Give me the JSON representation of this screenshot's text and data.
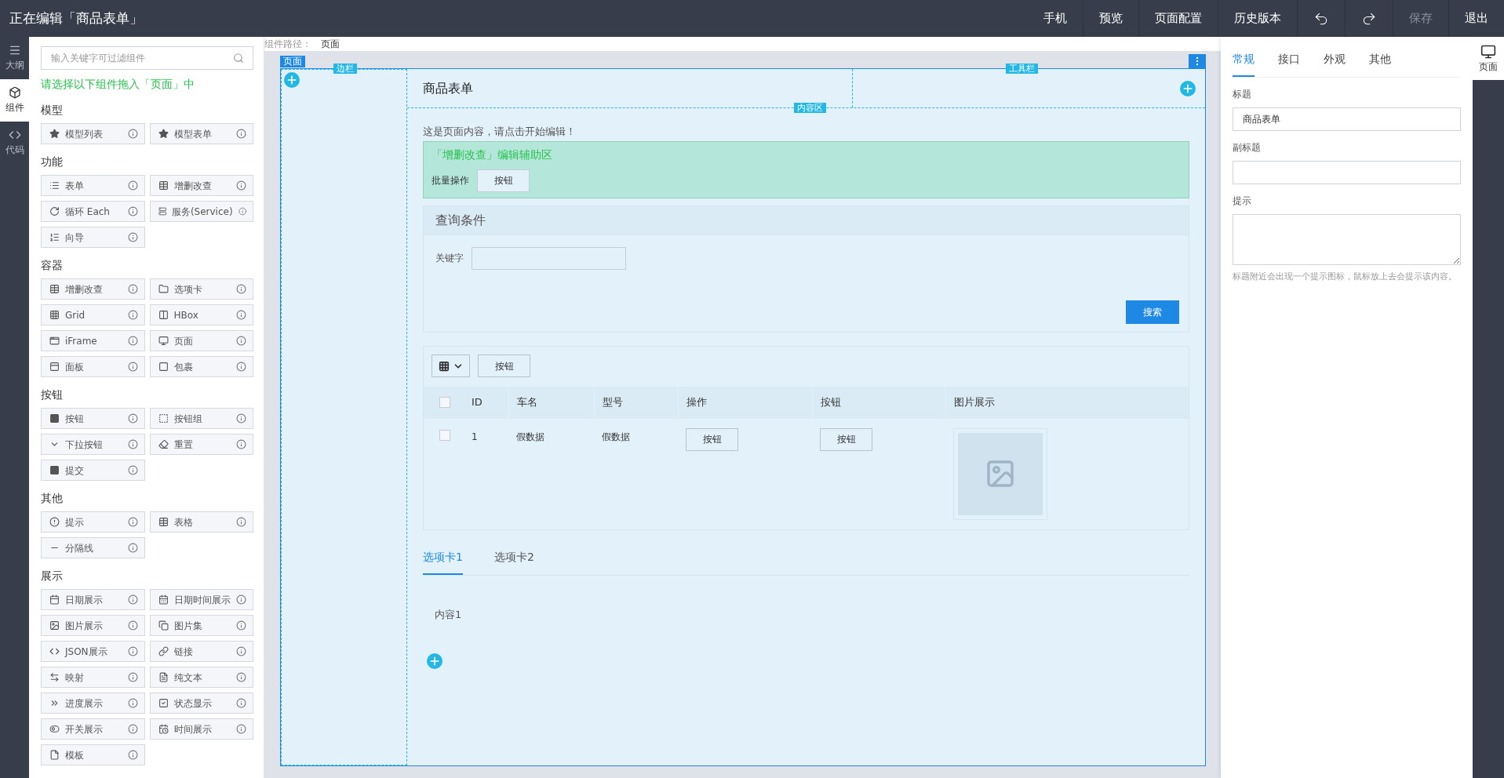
{
  "topbar": {
    "title": "正在编辑「商品表单」",
    "actions": [
      {
        "kind": "text",
        "label": "手机",
        "disabled": false
      },
      {
        "kind": "text",
        "label": "预览",
        "disabled": false
      },
      {
        "kind": "text",
        "label": "页面配置",
        "disabled": false
      },
      {
        "kind": "text",
        "label": "历史版本",
        "disabled": false
      },
      {
        "kind": "undo",
        "disabled": false
      },
      {
        "kind": "redo",
        "disabled": false
      },
      {
        "kind": "text",
        "label": "保存",
        "disabled": true
      },
      {
        "kind": "text",
        "label": "退出",
        "disabled": false
      }
    ]
  },
  "rail": [
    {
      "label": "大纲",
      "selected": false
    },
    {
      "label": "组件",
      "selected": true
    },
    {
      "label": "代码",
      "selected": false
    }
  ],
  "components_panel": {
    "search": {
      "placeholder": "输入关键字可过滤组件"
    },
    "hint": "请选择以下组件拖入「页面」中",
    "groups": [
      {
        "title": "模型",
        "items": [
          "模型列表",
          "模型表单"
        ]
      },
      {
        "title": "功能",
        "items": [
          "表单",
          "增删改查",
          "循环 Each",
          "服务(Service)",
          "向导"
        ]
      },
      {
        "title": "容器",
        "items": [
          "增删改查",
          "选项卡",
          "Grid",
          "HBox",
          "iFrame",
          "页面",
          "面板",
          "包裹"
        ]
      },
      {
        "title": "按钮",
        "items": [
          "按钮",
          "按钮组",
          "下拉按钮",
          "重置",
          "提交"
        ]
      },
      {
        "title": "其他",
        "items": [
          "提示",
          "表格",
          "分隔线"
        ]
      },
      {
        "title": "展示",
        "items": [
          "日期展示",
          "日期时间展示",
          "图片展示",
          "图片集",
          "JSON展示",
          "链接",
          "映射",
          "纯文本",
          "进度展示",
          "状态显示",
          "开关展示",
          "时间展示",
          "模板"
        ]
      }
    ]
  },
  "path": {
    "label": "组件路径：",
    "value": "页面"
  },
  "canvas": {
    "page_tag": "页面",
    "sidebar_tag": "边栏",
    "toolbar_tag": "工具栏",
    "content_tag": "内容区",
    "header_title": "商品表单",
    "intro": "这是页面内容，请点击开始编辑！",
    "crud_helper": {
      "title": "「增删改查」编辑辅助区",
      "batch_label": "批量操作",
      "button": "按钮"
    },
    "query": {
      "title": "查询条件",
      "field_label": "关键字",
      "search_button": "搜索"
    },
    "table": {
      "toolbar_button": "按钮",
      "columns": [
        "ID",
        "车名",
        "型号",
        "操作",
        "按钮",
        "图片展示"
      ],
      "header_checked": false,
      "rows": [
        {
          "checked": false,
          "id": "1",
          "name": "假数据",
          "model": "假数据",
          "action_button": "按钮",
          "button": "按钮"
        }
      ]
    },
    "tabs": [
      {
        "label": "选项卡1",
        "selected": true
      },
      {
        "label": "选项卡2",
        "selected": false
      }
    ],
    "tab_content": "内容1"
  },
  "settings": {
    "tabs": [
      {
        "label": "常规",
        "selected": true
      },
      {
        "label": "接口",
        "selected": false
      },
      {
        "label": "外观",
        "selected": false
      },
      {
        "label": "其他",
        "selected": false
      }
    ],
    "fields": [
      {
        "kind": "input",
        "label": "标题",
        "value": "商品表单"
      },
      {
        "kind": "input",
        "label": "副标题"
      },
      {
        "kind": "textarea",
        "label": "提示",
        "help": "标题附近会出现一个提示图标，鼠标放上去会提示该内容。"
      }
    ]
  },
  "right_rail": [
    {
      "label": "页面",
      "selected": true
    }
  ]
}
